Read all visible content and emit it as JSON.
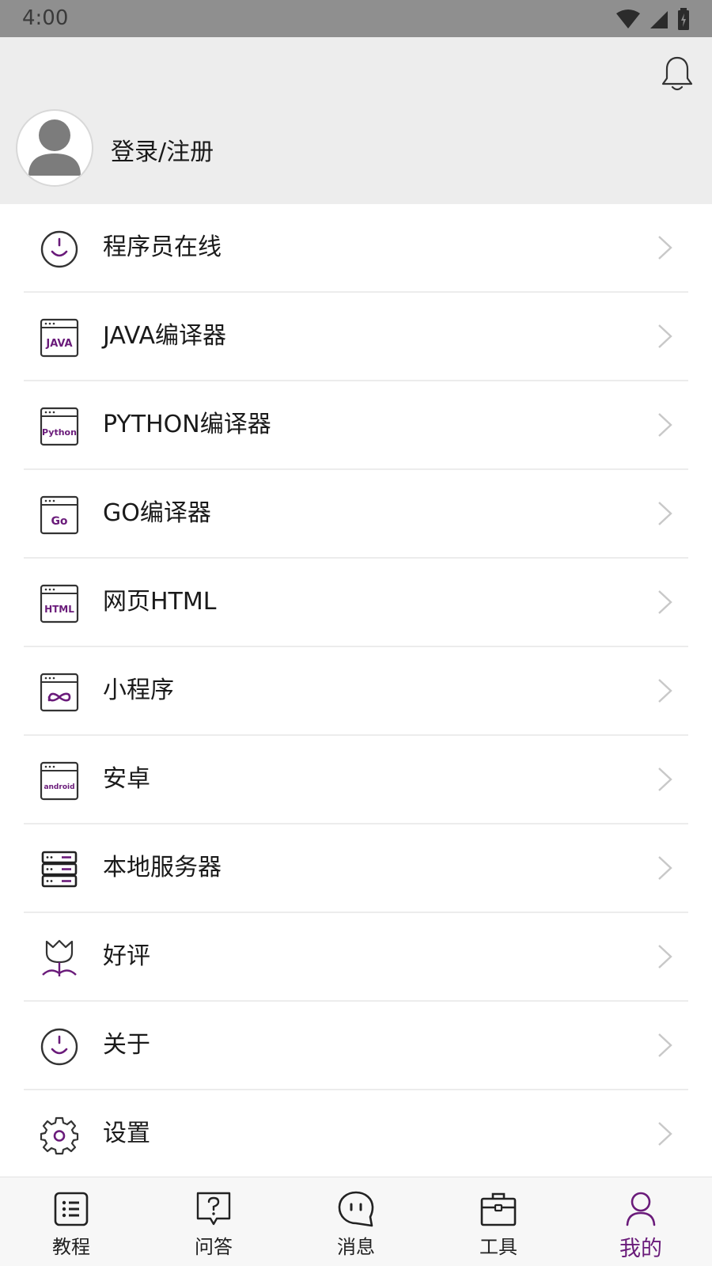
{
  "status_bar": {
    "time": "4:00"
  },
  "header": {
    "login_label": "登录/注册"
  },
  "menu": {
    "items": [
      {
        "label": "程序员在线",
        "icon": "smile-clock-icon"
      },
      {
        "label": "JAVA编译器",
        "icon": "java-window-icon",
        "icon_text": "JAVA"
      },
      {
        "label": "PYTHON编译器",
        "icon": "python-window-icon",
        "icon_text": "Python"
      },
      {
        "label": "GO编译器",
        "icon": "go-window-icon",
        "icon_text": "Go"
      },
      {
        "label": "网页HTML",
        "icon": "html-window-icon",
        "icon_text": "HTML"
      },
      {
        "label": "小程序",
        "icon": "miniprogram-window-icon"
      },
      {
        "label": "安卓",
        "icon": "android-window-icon",
        "icon_text": "android"
      },
      {
        "label": "本地服务器",
        "icon": "server-icon"
      },
      {
        "label": "好评",
        "icon": "tulip-icon"
      },
      {
        "label": "关于",
        "icon": "smile-clock-icon"
      },
      {
        "label": "设置",
        "icon": "gear-icon"
      }
    ]
  },
  "bottom_nav": {
    "items": [
      {
        "label": "教程",
        "icon": "tutorial-list-icon"
      },
      {
        "label": "问答",
        "icon": "question-bubble-icon"
      },
      {
        "label": "消息",
        "icon": "chat-bubble-icon"
      },
      {
        "label": "工具",
        "icon": "toolbox-icon"
      },
      {
        "label": "我的",
        "icon": "person-icon",
        "active": true
      }
    ]
  },
  "colors": {
    "accent": "#6a1b7a",
    "header_bg": "#ededed",
    "status_bar_bg": "#8f8f8f",
    "icon_stroke": "#333333"
  }
}
